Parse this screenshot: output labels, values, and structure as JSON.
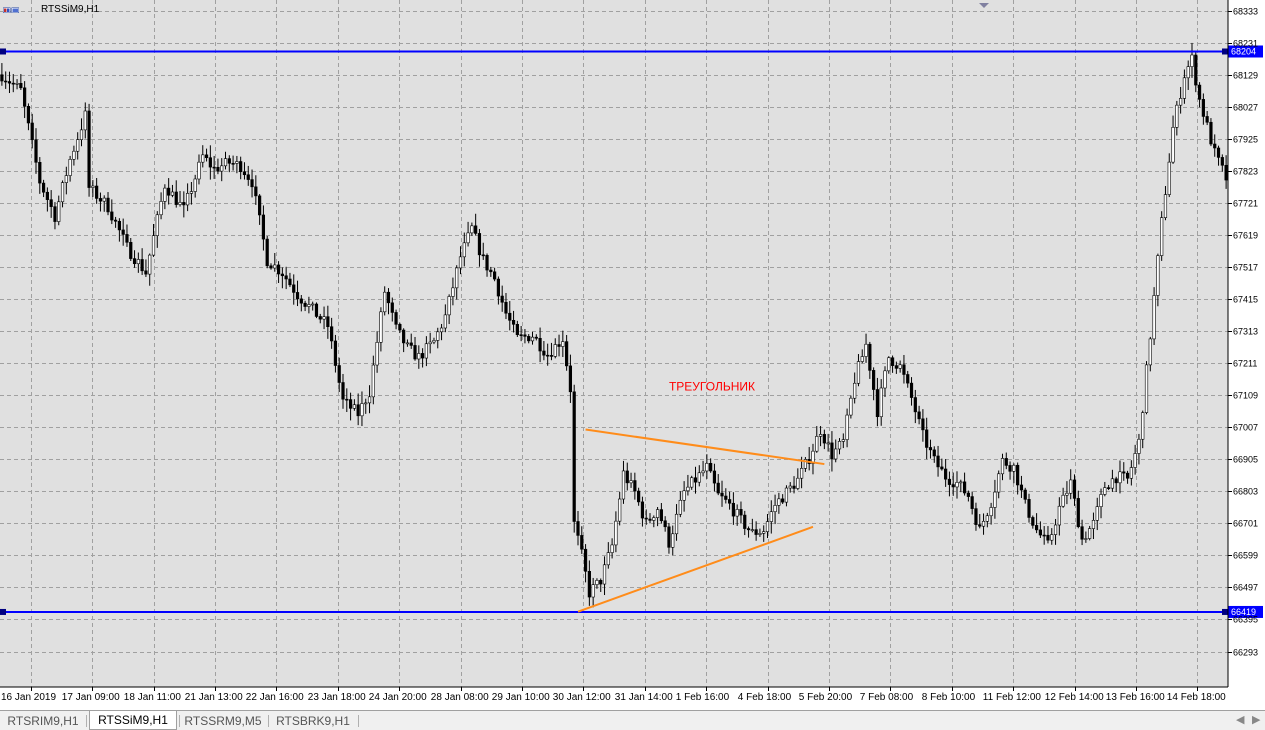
{
  "window": {
    "title": "RTSSiM9,H1"
  },
  "tabs": [
    {
      "label": "RTSRIM9,H1",
      "active": false
    },
    {
      "label": "RTSSiM9,H1",
      "active": true
    },
    {
      "label": "RTSSRM9,M5",
      "active": false
    },
    {
      "label": "RTSBRK9,H1",
      "active": false
    }
  ],
  "colors": {
    "background": "#ffffff",
    "plot_background": "#e0e0e0",
    "grid": "#a0a0a0",
    "bull_candle": "#00ff00",
    "bear_candle": "#000000",
    "level_line": "#0000ff",
    "trendline": "#ff8c1a",
    "annotation": "#ff0000"
  },
  "chart_data": {
    "type": "candlestick",
    "symbol": "RTSSiM9",
    "timeframe": "H1",
    "y_ticks": [
      68333,
      68231,
      68129,
      68027,
      67925,
      67823,
      67721,
      67619,
      67517,
      67415,
      67313,
      67211,
      67109,
      67007,
      66905,
      66803,
      66701,
      66599,
      66497,
      66395,
      66293
    ],
    "ylim": [
      66180,
      68368
    ],
    "x_ticks": [
      "16 Jan 2019",
      "17 Jan 09:00",
      "18 Jan 11:00",
      "21 Jan 13:00",
      "22 Jan 16:00",
      "23 Jan 18:00",
      "24 Jan 20:00",
      "28 Jan 08:00",
      "29 Jan 10:00",
      "30 Jan 12:00",
      "31 Jan 14:00",
      "1 Feb 16:00",
      "4 Feb 18:00",
      "5 Feb 20:00",
      "7 Feb 08:00",
      "8 Feb 10:00",
      "11 Feb 12:00",
      "12 Feb 14:00",
      "13 Feb 16:00",
      "14 Feb 18:00"
    ],
    "grid": true,
    "horizontal_levels": [
      {
        "price": 68204,
        "label": "68204"
      },
      {
        "price": 66419,
        "label": "66419"
      }
    ],
    "trendlines": [
      {
        "from": {
          "bar": 154,
          "price": 67000
        },
        "to": {
          "bar": 217,
          "price": 66890
        }
      },
      {
        "from": {
          "bar": 152,
          "price": 66420
        },
        "to": {
          "bar": 214,
          "price": 66690
        }
      }
    ],
    "annotation": {
      "text": "ТРЕУГОЛЬНИК",
      "bar": 176,
      "price": 67125
    },
    "path_points": [
      [
        0,
        68130
      ],
      [
        5,
        68080
      ],
      [
        10,
        67790
      ],
      [
        14,
        67680
      ],
      [
        18,
        67860
      ],
      [
        22,
        68000
      ],
      [
        23,
        67770
      ],
      [
        28,
        67710
      ],
      [
        33,
        67580
      ],
      [
        38,
        67500
      ],
      [
        43,
        67780
      ],
      [
        48,
        67700
      ],
      [
        53,
        67870
      ],
      [
        56,
        67830
      ],
      [
        60,
        67850
      ],
      [
        63,
        67840
      ],
      [
        66,
        67790
      ],
      [
        70,
        67540
      ],
      [
        74,
        67500
      ],
      [
        78,
        67430
      ],
      [
        82,
        67380
      ],
      [
        86,
        67330
      ],
      [
        90,
        67090
      ],
      [
        94,
        67050
      ],
      [
        97,
        67120
      ],
      [
        101,
        67440
      ],
      [
        104,
        67320
      ],
      [
        107,
        67260
      ],
      [
        110,
        67230
      ],
      [
        114,
        67280
      ],
      [
        117,
        67360
      ],
      [
        121,
        67550
      ],
      [
        124,
        67640
      ],
      [
        127,
        67540
      ],
      [
        130,
        67480
      ],
      [
        133,
        67370
      ],
      [
        136,
        67290
      ],
      [
        140,
        67300
      ],
      [
        144,
        67240
      ],
      [
        148,
        67290
      ],
      [
        150,
        67130
      ],
      [
        151,
        66700
      ],
      [
        153,
        66600
      ],
      [
        155,
        66480
      ],
      [
        158,
        66520
      ],
      [
        161,
        66630
      ],
      [
        164,
        66860
      ],
      [
        167,
        66800
      ],
      [
        170,
        66700
      ],
      [
        173,
        66750
      ],
      [
        176,
        66640
      ],
      [
        180,
        66800
      ],
      [
        183,
        66840
      ],
      [
        186,
        66880
      ],
      [
        189,
        66790
      ],
      [
        192,
        66760
      ],
      [
        195,
        66710
      ],
      [
        198,
        66670
      ],
      [
        201,
        66680
      ],
      [
        204,
        66760
      ],
      [
        207,
        66800
      ],
      [
        210,
        66840
      ],
      [
        213,
        66910
      ],
      [
        216,
        67000
      ],
      [
        219,
        66920
      ],
      [
        222,
        66960
      ],
      [
        225,
        67160
      ],
      [
        228,
        67270
      ],
      [
        231,
        67060
      ],
      [
        234,
        67230
      ],
      [
        237,
        67200
      ],
      [
        240,
        67100
      ],
      [
        243,
        66980
      ],
      [
        246,
        66900
      ],
      [
        249,
        66850
      ],
      [
        252,
        66830
      ],
      [
        255,
        66790
      ],
      [
        258,
        66680
      ],
      [
        261,
        66770
      ],
      [
        264,
        66900
      ],
      [
        267,
        66880
      ],
      [
        270,
        66760
      ],
      [
        273,
        66680
      ],
      [
        276,
        66630
      ],
      [
        279,
        66750
      ],
      [
        282,
        66830
      ],
      [
        285,
        66650
      ],
      [
        288,
        66700
      ],
      [
        291,
        66820
      ],
      [
        294,
        66850
      ],
      [
        297,
        66840
      ],
      [
        300,
        66960
      ],
      [
        303,
        67300
      ],
      [
        306,
        67660
      ],
      [
        309,
        67960
      ],
      [
        312,
        68130
      ],
      [
        314,
        68180
      ],
      [
        316,
        68050
      ],
      [
        320,
        67880
      ],
      [
        323,
        67800
      ]
    ],
    "bar_count": 324
  }
}
